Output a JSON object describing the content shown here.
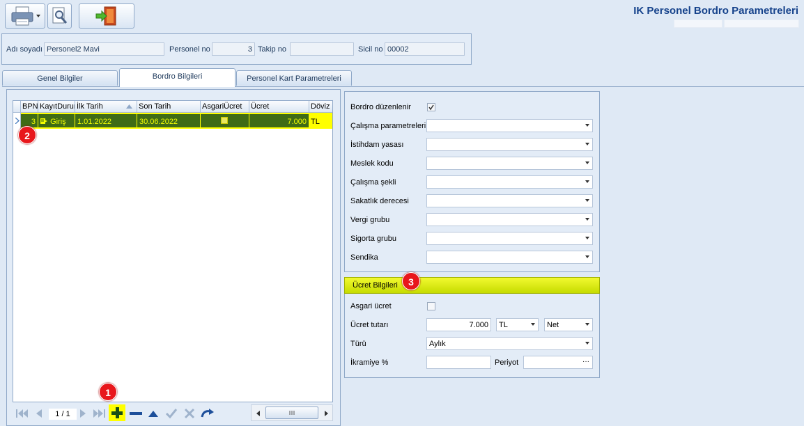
{
  "window": {
    "title": "IK Personel Bordro Parametreleri"
  },
  "header": {
    "fields": [
      {
        "label": "Adı soyadı",
        "value": "Personel2 Mavi"
      },
      {
        "label": "Personel no",
        "value": "3"
      },
      {
        "label": "Takip no",
        "value": ""
      },
      {
        "label": "Sicil no",
        "value": "00002"
      }
    ]
  },
  "tabs": [
    {
      "label": "Genel Bilgiler"
    },
    {
      "label": "Bordro Bilgileri"
    },
    {
      "label": "Personel Kart Parametreleri"
    }
  ],
  "grid": {
    "columns": [
      "BPN",
      "KayıtDurumu",
      "İlk Tarih",
      "Son Tarih",
      "AsgariÜcret",
      "Ücret",
      "Döviz"
    ],
    "rows": [
      {
        "bpn": "3",
        "kayit": "Giriş",
        "ilk": "1.01.2022",
        "son": "30.06.2022",
        "asgari": "",
        "ucret": "7.000",
        "doviz": "TL"
      }
    ],
    "pager": "1 / 1"
  },
  "bordro": {
    "bordro_duzenlenir": "Bordro düzenlenir",
    "fields": [
      {
        "label": "Çalışma parametreleri",
        "value": ""
      },
      {
        "label": "İstihdam yasası",
        "value": ""
      },
      {
        "label": "Meslek kodu",
        "value": ""
      },
      {
        "label": "Çalışma şekli",
        "value": ""
      },
      {
        "label": "Sakatlık derecesi",
        "value": ""
      },
      {
        "label": "Vergi grubu",
        "value": ""
      },
      {
        "label": "Sigorta grubu",
        "value": ""
      },
      {
        "label": "Sendika",
        "value": ""
      }
    ]
  },
  "ucret": {
    "section_title": "Ücret Bilgileri",
    "asgari_label": "Asgari ücret",
    "tutar_label": "Ücret tutarı",
    "tutar_value": "7.000",
    "currency": "TL",
    "net_brut": "Net",
    "turu_label": "Türü",
    "turu_value": "Aylık",
    "ikramiye_label": "İkramiye %",
    "ikramiye_value": "",
    "periyot_label": "Periyot",
    "periyot_value": "",
    "ellipsis": "···"
  },
  "badges": [
    "1",
    "2",
    "3"
  ],
  "colors": {
    "row_bg": "#3f6b16",
    "row_text": "#f4ff00",
    "highlight": "#ffff00",
    "badge": "#e8171c"
  }
}
